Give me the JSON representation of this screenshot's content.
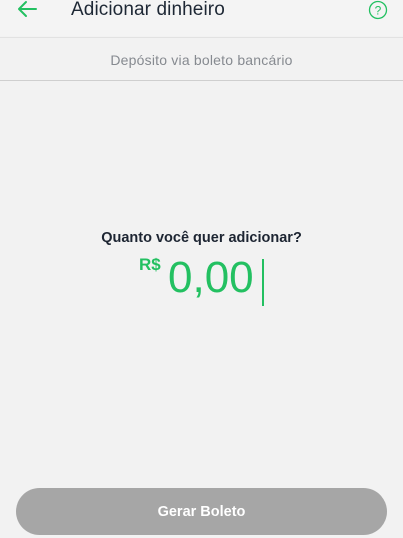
{
  "header": {
    "title": "Adicionar dinheiro",
    "back_icon": "arrow-left-icon",
    "help_icon": "question-circle-icon",
    "accent_color": "#23c061"
  },
  "subheader": {
    "text": "Depósito via boleto bancário"
  },
  "amount": {
    "question": "Quanto você quer adicionar?",
    "currency": "R$",
    "value": "0,00"
  },
  "footer": {
    "button_label": "Gerar Boleto",
    "button_color": "#a6a6a6"
  }
}
